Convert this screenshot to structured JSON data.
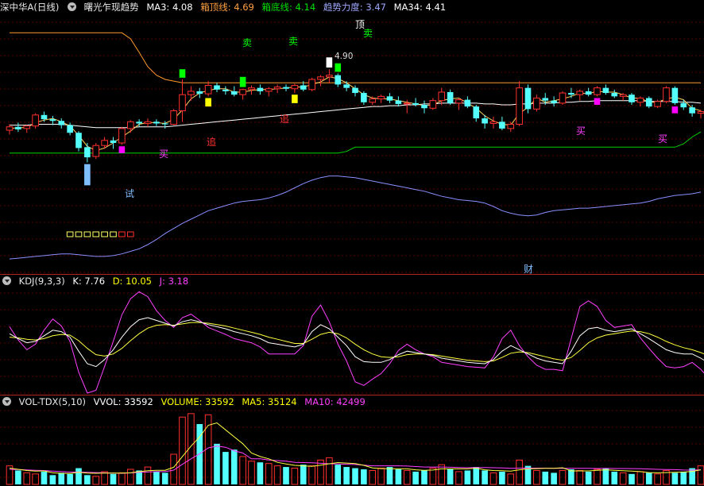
{
  "main": {
    "stock": "深中华A(日线)",
    "indicator": "曙光乍现趋势",
    "ma3": "MA3: 4.08",
    "box_top": "箱顶线: 4.69",
    "box_bottom": "箱底线: 4.14",
    "trend": "趋势力度: 3.47",
    "ma34": "MA34: 4.41",
    "peak_label": "顶",
    "peak_value": "4.90",
    "signals": {
      "sell": "卖",
      "buy": "买",
      "chase": "追",
      "try": "试",
      "wealth": "财"
    }
  },
  "kdj": {
    "name": "KDJ(9,3,3)",
    "k": "K: 7.76",
    "d": "D: 10.05",
    "j": "J: 3.18"
  },
  "vol": {
    "name": "VOL-TDX(5,10)",
    "wvol": "VVOL: 33592",
    "volume": "VOLUME: 33592",
    "ma5": "MA5: 35124",
    "ma10": "MA10: 42499"
  },
  "colors": {
    "up": "#ff3030",
    "down": "#54ffff",
    "sell": "#00ff00",
    "buy": "#ff00ff",
    "chase": "#ffff00",
    "try": "#7fbfff",
    "bg": "#000000"
  },
  "chart_data": {
    "type": "candlestick",
    "candles": [
      [
        4.2,
        4.27,
        4.15,
        4.24
      ],
      [
        4.24,
        4.29,
        4.18,
        4.21
      ],
      [
        4.22,
        4.26,
        4.17,
        4.25
      ],
      [
        4.25,
        4.4,
        4.22,
        4.38
      ],
      [
        4.38,
        4.42,
        4.3,
        4.33
      ],
      [
        4.33,
        4.37,
        4.26,
        4.31
      ],
      [
        4.31,
        4.34,
        4.22,
        4.26
      ],
      [
        4.26,
        4.29,
        4.14,
        4.17
      ],
      [
        4.17,
        4.19,
        3.95,
        3.99
      ],
      [
        4.0,
        4.05,
        3.82,
        3.88
      ],
      [
        3.89,
        4.05,
        3.86,
        4.02
      ],
      [
        4.02,
        4.12,
        3.98,
        4.08
      ],
      [
        4.08,
        4.12,
        3.98,
        4.05
      ],
      [
        4.05,
        4.24,
        4.03,
        4.22
      ],
      [
        4.22,
        4.32,
        4.17,
        4.3
      ],
      [
        4.3,
        4.33,
        4.24,
        4.28
      ],
      [
        4.28,
        4.34,
        4.24,
        4.3
      ],
      [
        4.3,
        4.33,
        4.25,
        4.28
      ],
      [
        4.28,
        4.31,
        4.22,
        4.27
      ],
      [
        4.27,
        4.45,
        4.26,
        4.43
      ],
      [
        4.43,
        4.8,
        4.3,
        4.62
      ],
      [
        4.62,
        4.72,
        4.55,
        4.66
      ],
      [
        4.66,
        4.7,
        4.58,
        4.63
      ],
      [
        4.63,
        4.78,
        4.6,
        4.73
      ],
      [
        4.73,
        4.76,
        4.65,
        4.68
      ],
      [
        4.68,
        4.72,
        4.62,
        4.66
      ],
      [
        4.66,
        4.72,
        4.6,
        4.62
      ],
      [
        4.62,
        4.69,
        4.56,
        4.68
      ],
      [
        4.68,
        4.73,
        4.62,
        4.7
      ],
      [
        4.7,
        4.74,
        4.62,
        4.66
      ],
      [
        4.66,
        4.71,
        4.6,
        4.69
      ],
      [
        4.69,
        4.74,
        4.64,
        4.71
      ],
      [
        4.71,
        4.74,
        4.66,
        4.69
      ],
      [
        4.69,
        4.75,
        4.64,
        4.73
      ],
      [
        4.73,
        4.78,
        4.66,
        4.68
      ],
      [
        4.68,
        4.82,
        4.66,
        4.8
      ],
      [
        4.8,
        4.85,
        4.72,
        4.83
      ],
      [
        4.83,
        4.92,
        4.75,
        4.85
      ],
      [
        4.85,
        4.87,
        4.71,
        4.74
      ],
      [
        4.74,
        4.78,
        4.66,
        4.7
      ],
      [
        4.7,
        4.73,
        4.6,
        4.64
      ],
      [
        4.64,
        4.66,
        4.5,
        4.53
      ],
      [
        4.53,
        4.6,
        4.5,
        4.57
      ],
      [
        4.57,
        4.62,
        4.52,
        4.6
      ],
      [
        4.6,
        4.64,
        4.52,
        4.55
      ],
      [
        4.55,
        4.6,
        4.48,
        4.51
      ],
      [
        4.51,
        4.56,
        4.4,
        4.52
      ],
      [
        4.52,
        4.58,
        4.48,
        4.5
      ],
      [
        4.5,
        4.55,
        4.4,
        4.46
      ],
      [
        4.46,
        4.58,
        4.44,
        4.55
      ],
      [
        4.55,
        4.7,
        4.5,
        4.65
      ],
      [
        4.65,
        4.68,
        4.5,
        4.52
      ],
      [
        4.52,
        4.58,
        4.44,
        4.56
      ],
      [
        4.56,
        4.6,
        4.46,
        4.48
      ],
      [
        4.48,
        4.5,
        4.3,
        4.34
      ],
      [
        4.34,
        4.38,
        4.22,
        4.28
      ],
      [
        4.28,
        4.36,
        4.22,
        4.3
      ],
      [
        4.3,
        4.36,
        4.2,
        4.22
      ],
      [
        4.22,
        4.3,
        4.18,
        4.27
      ],
      [
        4.27,
        4.78,
        4.25,
        4.7
      ],
      [
        4.7,
        4.74,
        4.4,
        4.45
      ],
      [
        4.45,
        4.62,
        4.42,
        4.58
      ],
      [
        4.58,
        4.64,
        4.5,
        4.55
      ],
      [
        4.55,
        4.6,
        4.48,
        4.52
      ],
      [
        4.52,
        4.66,
        4.5,
        4.64
      ],
      [
        4.64,
        4.7,
        4.58,
        4.62
      ],
      [
        4.62,
        4.68,
        4.55,
        4.66
      ],
      [
        4.66,
        4.7,
        4.6,
        4.62
      ],
      [
        4.62,
        4.72,
        4.6,
        4.7
      ],
      [
        4.7,
        4.74,
        4.62,
        4.64
      ],
      [
        4.64,
        4.68,
        4.58,
        4.6
      ],
      [
        4.6,
        4.64,
        4.55,
        4.62
      ],
      [
        4.62,
        4.64,
        4.5,
        4.53
      ],
      [
        4.53,
        4.6,
        4.48,
        4.58
      ],
      [
        4.58,
        4.6,
        4.46,
        4.48
      ],
      [
        4.48,
        4.56,
        4.46,
        4.54
      ],
      [
        4.54,
        4.72,
        4.52,
        4.7
      ],
      [
        4.7,
        4.72,
        4.5,
        4.52
      ],
      [
        4.52,
        4.56,
        4.44,
        4.47
      ],
      [
        4.47,
        4.5,
        4.36,
        4.4
      ],
      [
        4.4,
        4.44,
        4.34,
        4.42
      ]
    ],
    "ma3": [
      4.22,
      4.23,
      4.23,
      4.29,
      4.32,
      4.34,
      4.3,
      4.25,
      4.14,
      4.01,
      3.96,
      3.99,
      4.05,
      4.12,
      4.19,
      4.27,
      4.29,
      4.29,
      4.28,
      4.33,
      4.44,
      4.57,
      4.64,
      4.67,
      4.69,
      4.69,
      4.65,
      4.65,
      4.67,
      4.68,
      4.68,
      4.69,
      4.7,
      4.71,
      4.71,
      4.74,
      4.77,
      4.83,
      4.81,
      4.76,
      4.69,
      4.62,
      4.58,
      4.57,
      4.57,
      4.55,
      4.53,
      4.51,
      4.49,
      4.5,
      4.55,
      4.57,
      4.58,
      4.52,
      4.46,
      4.37,
      4.31,
      4.27,
      4.26,
      4.4,
      4.47,
      4.58,
      4.53,
      4.55,
      4.57,
      4.6,
      4.64,
      4.63,
      4.66,
      4.65,
      4.65,
      4.62,
      4.58,
      4.58,
      4.53,
      4.53,
      4.57,
      4.59,
      4.56,
      4.46,
      4.43
    ],
    "ma34": [
      4.26,
      4.26,
      4.26,
      4.27,
      4.27,
      4.27,
      4.27,
      4.26,
      4.25,
      4.24,
      4.23,
      4.23,
      4.23,
      4.23,
      4.23,
      4.24,
      4.24,
      4.24,
      4.24,
      4.25,
      4.26,
      4.27,
      4.28,
      4.29,
      4.3,
      4.31,
      4.32,
      4.33,
      4.34,
      4.35,
      4.36,
      4.37,
      4.38,
      4.39,
      4.4,
      4.41,
      4.42,
      4.43,
      4.44,
      4.45,
      4.46,
      4.47,
      4.48,
      4.48,
      4.49,
      4.49,
      4.5,
      4.5,
      4.51,
      4.51,
      4.52,
      4.52,
      4.52,
      4.52,
      4.52,
      4.51,
      4.51,
      4.5,
      4.5,
      4.51,
      4.51,
      4.52,
      4.52,
      4.52,
      4.53,
      4.53,
      4.54,
      4.54,
      4.55,
      4.55,
      4.55,
      4.55,
      4.55,
      4.55,
      4.54,
      4.54,
      4.54,
      4.54,
      4.53,
      4.53,
      4.52
    ],
    "box_top_line": [
      5.35,
      5.35,
      5.35,
      5.35,
      5.35,
      5.35,
      5.35,
      5.35,
      5.35,
      5.35,
      5.35,
      5.35,
      5.35,
      5.35,
      5.28,
      5.12,
      4.95,
      4.85,
      4.8,
      4.78,
      4.76,
      4.76,
      4.76,
      4.76,
      4.76,
      4.76,
      4.76,
      4.76,
      4.76,
      4.76,
      4.76,
      4.76,
      4.76,
      4.76,
      4.76,
      4.76,
      4.76,
      4.76,
      4.76,
      4.76,
      4.76,
      4.76,
      4.76,
      4.76,
      4.76,
      4.76,
      4.76,
      4.76,
      4.76,
      4.76,
      4.76,
      4.76,
      4.76,
      4.76,
      4.76,
      4.76,
      4.76,
      4.76,
      4.76,
      4.76,
      4.76,
      4.76,
      4.76,
      4.76,
      4.76,
      4.76,
      4.76,
      4.76,
      4.76,
      4.76,
      4.76,
      4.76,
      4.76,
      4.76,
      4.76,
      4.76,
      4.76,
      4.76,
      4.76,
      4.76,
      4.76
    ],
    "box_bottom_line": [
      3.93,
      3.93,
      3.93,
      3.93,
      3.93,
      3.93,
      3.93,
      3.93,
      3.93,
      3.93,
      3.93,
      3.93,
      3.93,
      3.93,
      3.93,
      3.93,
      3.93,
      3.93,
      3.93,
      3.93,
      3.93,
      3.93,
      3.93,
      3.93,
      3.93,
      3.93,
      3.93,
      3.93,
      3.93,
      3.93,
      3.93,
      3.93,
      3.93,
      3.93,
      3.93,
      3.93,
      3.93,
      3.93,
      3.93,
      3.95,
      4.0,
      4.0,
      4.0,
      4.0,
      4.0,
      4.0,
      4.0,
      4.0,
      4.0,
      4.0,
      4.0,
      4.0,
      4.0,
      4.0,
      4.0,
      4.0,
      4.0,
      4.0,
      4.0,
      4.0,
      4.0,
      4.0,
      4.0,
      4.0,
      4.0,
      4.0,
      4.0,
      4.0,
      4.0,
      4.0,
      4.0,
      4.0,
      4.0,
      4.0,
      4.0,
      4.0,
      4.0,
      4.0,
      4.04,
      4.12,
      4.18
    ],
    "trend_line": [
      2.68,
      2.69,
      2.7,
      2.71,
      2.72,
      2.73,
      2.74,
      2.74,
      2.73,
      2.72,
      2.71,
      2.71,
      2.72,
      2.74,
      2.77,
      2.8,
      2.85,
      2.91,
      2.98,
      3.04,
      3.1,
      3.15,
      3.2,
      3.25,
      3.28,
      3.31,
      3.34,
      3.36,
      3.37,
      3.38,
      3.4,
      3.43,
      3.47,
      3.52,
      3.57,
      3.61,
      3.64,
      3.66,
      3.66,
      3.65,
      3.64,
      3.62,
      3.6,
      3.58,
      3.56,
      3.54,
      3.52,
      3.5,
      3.48,
      3.45,
      3.42,
      3.4,
      3.38,
      3.37,
      3.36,
      3.34,
      3.3,
      3.25,
      3.22,
      3.2,
      3.19,
      3.2,
      3.23,
      3.25,
      3.26,
      3.27,
      3.28,
      3.28,
      3.29,
      3.3,
      3.31,
      3.32,
      3.33,
      3.34,
      3.36,
      3.39,
      3.41,
      3.43,
      3.44,
      3.45,
      3.47
    ],
    "kdj_k": [
      55,
      48,
      42,
      44,
      52,
      60,
      58,
      50,
      30,
      12,
      8,
      18,
      32,
      50,
      65,
      75,
      78,
      74,
      70,
      66,
      72,
      75,
      72,
      68,
      65,
      62,
      58,
      55,
      52,
      48,
      42,
      40,
      38,
      36,
      40,
      58,
      68,
      62,
      50,
      38,
      22,
      15,
      14,
      14,
      18,
      25,
      30,
      28,
      26,
      24,
      20,
      18,
      16,
      14,
      13,
      12,
      18,
      30,
      38,
      32,
      26,
      20,
      16,
      14,
      12,
      30,
      52,
      62,
      64,
      60,
      58,
      60,
      62,
      55,
      48,
      40,
      32,
      28,
      26,
      26,
      20,
      12,
      8
    ],
    "kdj_d": [
      50,
      49,
      47,
      46,
      48,
      52,
      54,
      53,
      45,
      34,
      25,
      23,
      26,
      34,
      45,
      55,
      63,
      67,
      68,
      67,
      69,
      71,
      71,
      70,
      68,
      66,
      63,
      60,
      57,
      54,
      50,
      47,
      44,
      41,
      41,
      47,
      54,
      57,
      55,
      49,
      40,
      32,
      26,
      22,
      21,
      22,
      25,
      26,
      26,
      25,
      23,
      21,
      19,
      17,
      16,
      15,
      16,
      21,
      27,
      29,
      28,
      25,
      22,
      19,
      17,
      21,
      31,
      42,
      49,
      53,
      55,
      57,
      59,
      58,
      55,
      50,
      44,
      39,
      35,
      32,
      28,
      23,
      18
    ],
    "kdj_j": [
      65,
      46,
      32,
      40,
      60,
      76,
      66,
      44,
      0,
      -30,
      -26,
      8,
      44,
      82,
      105,
      115,
      108,
      88,
      74,
      64,
      78,
      83,
      74,
      64,
      59,
      54,
      48,
      45,
      42,
      36,
      26,
      26,
      26,
      26,
      38,
      80,
      96,
      72,
      40,
      16,
      -14,
      -19,
      -10,
      -2,
      12,
      31,
      40,
      32,
      26,
      22,
      14,
      12,
      10,
      8,
      7,
      6,
      22,
      48,
      60,
      38,
      22,
      10,
      4,
      4,
      2,
      48,
      94,
      102,
      94,
      74,
      64,
      66,
      68,
      49,
      34,
      20,
      8,
      6,
      8,
      14,
      4,
      -10,
      -12
    ],
    "volume": [
      16000,
      12000,
      10000,
      9000,
      11000,
      8000,
      10000,
      9000,
      14000,
      8000,
      7000,
      11000,
      9000,
      10000,
      13000,
      12000,
      15000,
      11000,
      10000,
      26000,
      58000,
      61000,
      52000,
      60000,
      35000,
      28000,
      30000,
      24000,
      20000,
      19000,
      18000,
      16000,
      15000,
      14000,
      17000,
      16000,
      21000,
      23000,
      17000,
      15000,
      14000,
      13000,
      12000,
      14000,
      15000,
      13000,
      12000,
      11000,
      12000,
      14000,
      17000,
      13000,
      11000,
      12000,
      15000,
      12000,
      10000,
      11000,
      9000,
      21000,
      16000,
      12000,
      11000,
      10000,
      12000,
      13000,
      12000,
      11000,
      13000,
      14000,
      11000,
      10000,
      9000,
      11000,
      10000,
      9000,
      12000,
      10000,
      11000,
      14000,
      16000
    ],
    "vol_ma5": [
      14000,
      13000,
      12000,
      11500,
      11600,
      10000,
      9600,
      9400,
      10400,
      9800,
      9600,
      9800,
      9800,
      9800,
      10000,
      11000,
      11800,
      12200,
      12200,
      14800,
      24000,
      33000,
      41000,
      51000,
      53000,
      47000,
      41000,
      35000,
      27000,
      24000,
      22000,
      19000,
      17600,
      16400,
      16000,
      15600,
      16600,
      17800,
      18800,
      18400,
      18000,
      16400,
      14200,
      13600,
      13600,
      13400,
      13400,
      12600,
      12200,
      12400,
      13400,
      13400,
      13400,
      13400,
      14000,
      12600,
      12000,
      11800,
      11400,
      12600,
      13400,
      13600,
      13800,
      13800,
      14400,
      11600,
      11600,
      11600,
      12200,
      12600,
      12200,
      11800,
      11400,
      11000,
      10200,
      10000,
      10200,
      10400,
      10600,
      11200,
      12600
    ],
    "vol_ma10": [
      13000,
      12800,
      12500,
      12200,
      12000,
      11500,
      11000,
      10600,
      10600,
      10500,
      10200,
      10000,
      9700,
      9600,
      9900,
      10400,
      10700,
      11000,
      11000,
      12300,
      17300,
      22000,
      26400,
      31500,
      33000,
      32000,
      29000,
      27000,
      22000,
      22000,
      21000,
      20500,
      20000,
      19000,
      18800,
      18600,
      18200,
      17800,
      17600,
      17400,
      17200,
      16600,
      16000,
      16000,
      16000,
      16000,
      15800,
      15400,
      15000,
      15000,
      15000,
      14800,
      14500,
      14400,
      14600,
      14600,
      14400,
      14200,
      13900,
      14000,
      14000,
      14000,
      14000,
      13800,
      13800,
      13800,
      13800,
      13800,
      13700,
      13800,
      13700,
      13700,
      13600,
      13500,
      13300,
      13000,
      12800,
      12700,
      12400,
      12300,
      12600
    ]
  }
}
